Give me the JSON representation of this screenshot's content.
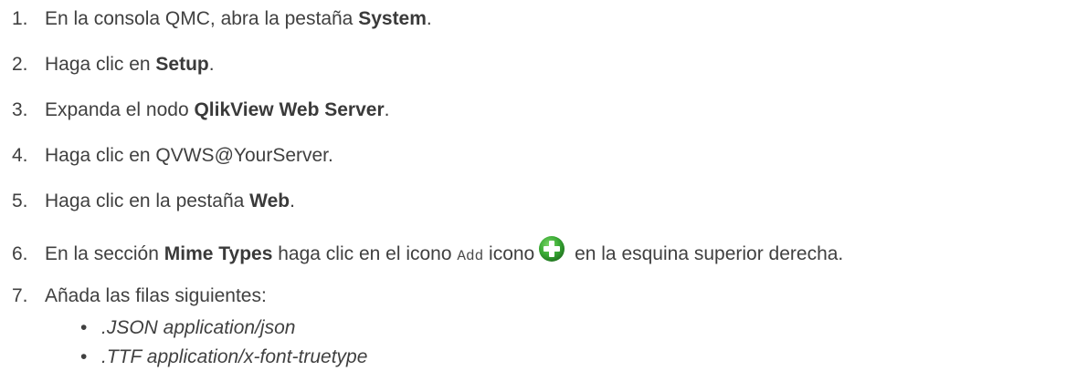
{
  "steps": [
    {
      "num": "1.",
      "pre": "En la consola QMC, abra la pestaña ",
      "bold": "System",
      "post": "."
    },
    {
      "num": "2.",
      "pre": "Haga clic en ",
      "bold": "Setup",
      "post": "."
    },
    {
      "num": "3.",
      "pre": "Expanda el nodo ",
      "bold": "QlikView Web Server",
      "post": "."
    },
    {
      "num": "4.",
      "text": "Haga clic en QVWS@YourServer."
    },
    {
      "num": "5.",
      "pre": "Haga clic en la pestaña ",
      "bold": "Web",
      "post": "."
    },
    {
      "num": "6.",
      "pre": "En la sección ",
      "bold": "Mime Types",
      "mid": " haga clic en el icono ",
      "code": "Add",
      "mid2": " icono",
      "post": " en la esquina superior derecha."
    },
    {
      "num": "7.",
      "text": "Añada las filas siguientes:"
    }
  ],
  "subitems": [
    {
      "bullet": "•",
      "text": ".JSON application/json"
    },
    {
      "bullet": "•",
      "text": ".TTF application/x-font-truetype"
    }
  ],
  "icons": {
    "add": {
      "name": "add-plus-icon",
      "color": "#3aaa35"
    }
  }
}
